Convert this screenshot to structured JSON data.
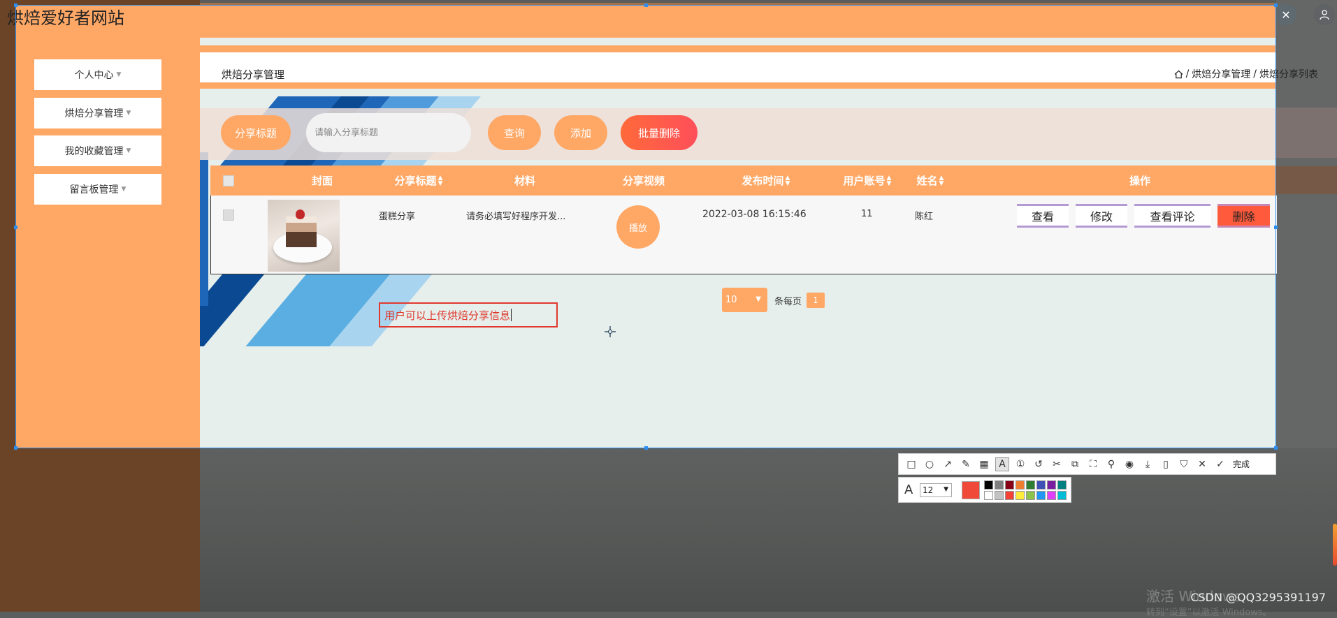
{
  "app": {
    "title": "烘焙爱好者网站"
  },
  "sidebar": {
    "items": [
      {
        "label": "个人中心"
      },
      {
        "label": "烘焙分享管理"
      },
      {
        "label": "我的收藏管理"
      },
      {
        "label": "留言板管理"
      }
    ]
  },
  "header": {
    "page_title": "烘焙分享管理",
    "breadcrumb": [
      "烘焙分享管理",
      "烘焙分享列表"
    ],
    "breadcrumb_sep": "/"
  },
  "toolbar": {
    "search_label": "分享标题",
    "search_placeholder": "请输入分享标题",
    "query_label": "查询",
    "add_label": "添加",
    "batch_delete_label": "批量删除"
  },
  "table": {
    "columns": [
      "封面",
      "分享标题",
      "材料",
      "分享视频",
      "发布时间",
      "用户账号",
      "姓名",
      "操作"
    ],
    "rows": [
      {
        "title": "蛋糕分享",
        "material": "请务必填写好程序开发...",
        "video_button": "播放",
        "time": "2022-03-08 16:15:46",
        "account": "11",
        "name": "陈红",
        "actions": {
          "view": "查看",
          "edit": "修改",
          "comments": "查看评论",
          "delete": "删除"
        }
      }
    ]
  },
  "pagination": {
    "page_size": "10",
    "per_page_label": "条每页",
    "current_page": "1"
  },
  "annotation": {
    "text": "用户可以上传烘焙分享信息"
  },
  "snip_toolbar": {
    "done_label": "完成",
    "font_size": "12",
    "current_color": "#f0493a",
    "palette": [
      "#000000",
      "#7f7f7f",
      "#880015",
      "#ed7d31",
      "#2e7d32",
      "#3f51b5",
      "#7b1fa2",
      "#008080",
      "#ffffff",
      "#c3c3c3",
      "#f44336",
      "#ffeb3b",
      "#8bc34a",
      "#2196f3",
      "#e040fb",
      "#00bcd4"
    ]
  },
  "watermark": {
    "text1": "激活 Windows",
    "text2": "转到“设置”以激活 Windows。",
    "csdn": "CSDN @QQ3295391197"
  },
  "colors": {
    "accent": "#ffa866",
    "danger": "#ff5a3c",
    "selection": "#2d8ef0"
  }
}
